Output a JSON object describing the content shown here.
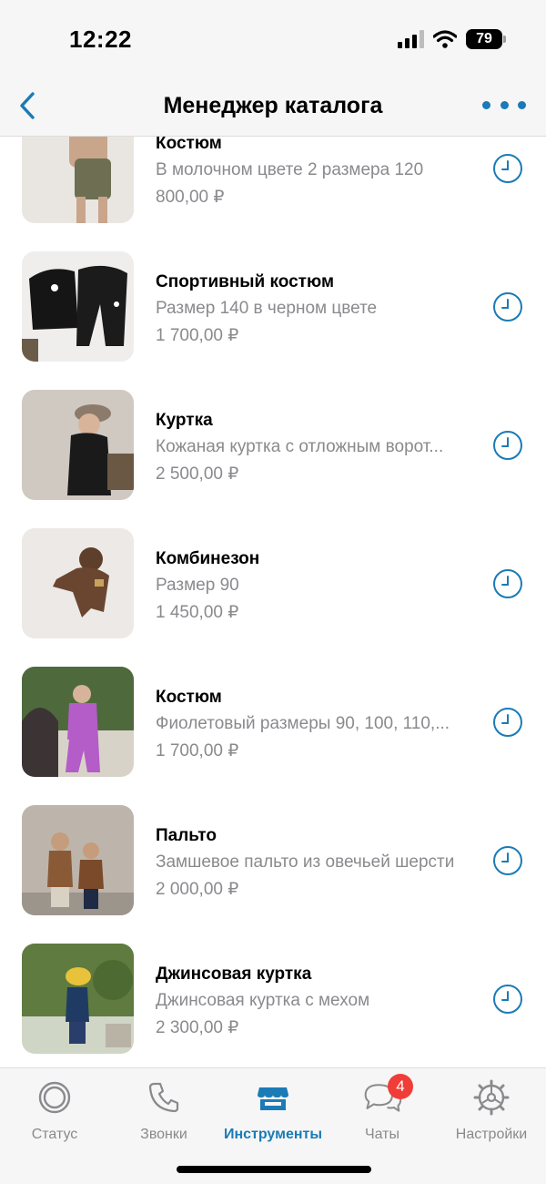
{
  "status_bar": {
    "time": "12:22",
    "battery": "79"
  },
  "nav": {
    "title": "Менеджер каталога",
    "back_icon": "chevron-left-icon",
    "more_icon": "more-dots-icon"
  },
  "colors": {
    "accent": "#1a7bb6",
    "badge": "#f03d38",
    "secondary_text": "#8a8a8e"
  },
  "items": [
    {
      "title": "Костюм",
      "description": "В молочном цвете 2 размера 120",
      "price": "800,00 ₽"
    },
    {
      "title": "Спортивный костюм",
      "description": "Размер 140 в черном цвете",
      "price": "1 700,00 ₽"
    },
    {
      "title": "Куртка",
      "description": "Кожаная куртка с отложным ворот...",
      "price": "2 500,00 ₽"
    },
    {
      "title": "Комбинезон",
      "description": "Размер 90",
      "price": "1 450,00 ₽"
    },
    {
      "title": "Костюм",
      "description": "Фиолетовый размеры 90, 100, 110,...",
      "price": "1 700,00 ₽"
    },
    {
      "title": "Пальто",
      "description": "Замшевое пальто из овечьей шерсти",
      "price": "2 000,00 ₽"
    },
    {
      "title": "Джинсовая куртка",
      "description": "Джинсовая куртка с мехом",
      "price": "2 300,00 ₽"
    }
  ],
  "tabs": [
    {
      "label": "Статус",
      "icon": "status-icon",
      "active": false
    },
    {
      "label": "Звонки",
      "icon": "phone-icon",
      "active": false
    },
    {
      "label": "Инструменты",
      "icon": "store-icon",
      "active": true
    },
    {
      "label": "Чаты",
      "icon": "chats-icon",
      "active": false,
      "badge": "4"
    },
    {
      "label": "Настройки",
      "icon": "gear-icon",
      "active": false
    }
  ]
}
